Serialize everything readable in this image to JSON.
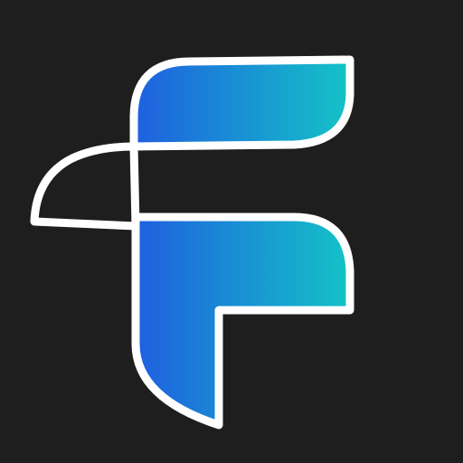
{
  "icon": {
    "name": "f-logo-icon",
    "colors": {
      "background": "#1e1e1e",
      "outline": "#ffffff",
      "gradient_start": "#1f5fe0",
      "gradient_end": "#13c3c7",
      "tab_fill": "#1e1e1e"
    }
  }
}
